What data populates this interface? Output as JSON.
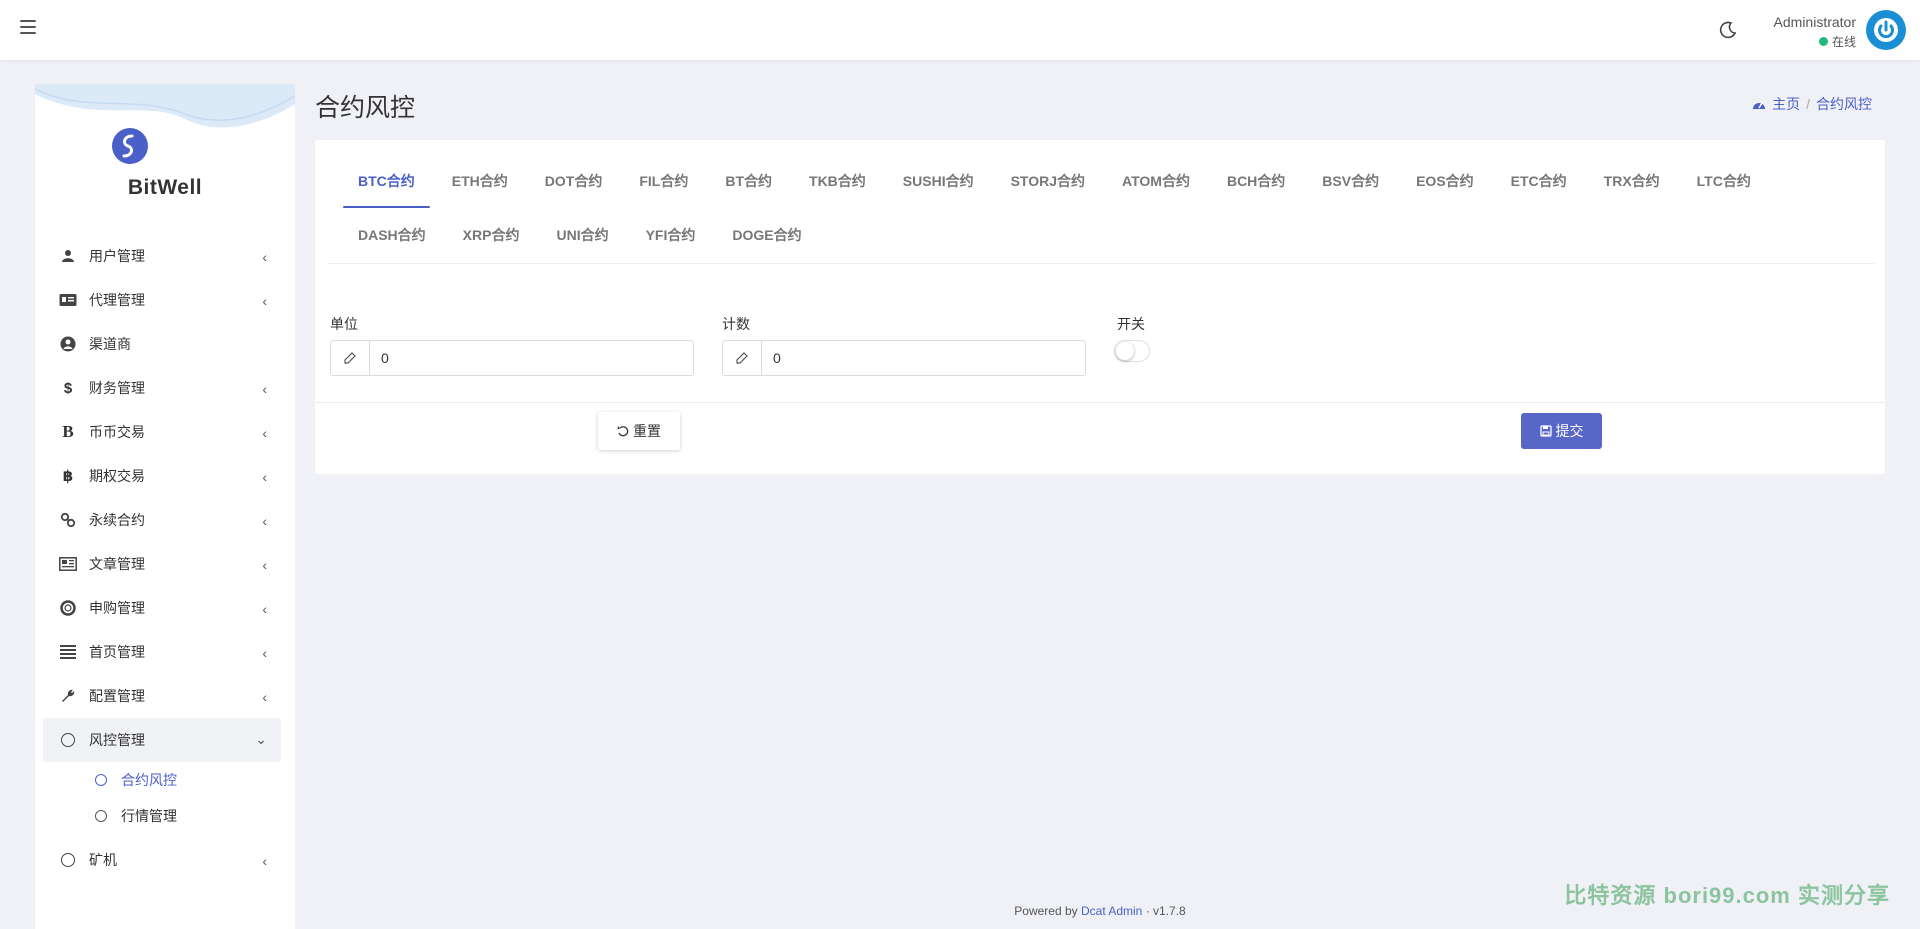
{
  "header": {
    "user_name": "Administrator",
    "user_status": "在线",
    "status_color": "#21b978"
  },
  "sidebar": {
    "logo_text": "BitWell",
    "items": [
      {
        "label": "用户管理",
        "icon": "users-icon"
      },
      {
        "label": "代理管理",
        "icon": "id-card-icon"
      },
      {
        "label": "渠道商",
        "icon": "user-circle-icon"
      },
      {
        "label": "财务管理",
        "icon": "dollar-icon"
      },
      {
        "label": "币币交易",
        "icon": "bold-b-icon"
      },
      {
        "label": "期权交易",
        "icon": "bitcoin-icon"
      },
      {
        "label": "永续合约",
        "icon": "link-icon"
      },
      {
        "label": "文章管理",
        "icon": "newspaper-icon"
      },
      {
        "label": "申购管理",
        "icon": "life-ring-icon"
      },
      {
        "label": "首页管理",
        "icon": "list-icon"
      },
      {
        "label": "配置管理",
        "icon": "wrench-icon"
      },
      {
        "label": "风控管理",
        "icon": "circle-icon"
      }
    ],
    "subitems": [
      {
        "label": "合约风控"
      },
      {
        "label": "行情管理"
      }
    ],
    "last_item": {
      "label": "矿机",
      "icon": "circle-icon"
    }
  },
  "page": {
    "title": "合约风控",
    "breadcrumb_home": "主页",
    "breadcrumb_current": "合约风控",
    "breadcrumb_sep": "/"
  },
  "tabs_row1": [
    "BTC合约",
    "ETH合约",
    "DOT合约",
    "FIL合约",
    "BT合约",
    "TKB合约",
    "SUSHI合约",
    "STORJ合约",
    "ATOM合约",
    "BCH合约",
    "BSV合约",
    "EOS合约",
    "ETC合约",
    "TRX合约",
    "LTC合约"
  ],
  "tabs_row2": [
    "DASH合约",
    "XRP合约",
    "UNI合约",
    "YFI合约",
    "DOGE合约"
  ],
  "form": {
    "unit_label": "单位",
    "unit_value": "0",
    "count_label": "计数",
    "count_value": "0",
    "switch_label": "开关",
    "reset_label": "重置",
    "submit_label": "提交"
  },
  "footer": {
    "powered_prefix": "Powered by",
    "powered_link": "Dcat Admin",
    "sep": "·",
    "version": "v1.7.8"
  },
  "watermark": "比特资源 bori99.com 实测分享",
  "colors": {
    "accent": "#4b5fc8",
    "submit": "#5866c8",
    "background": "#eff1f6"
  }
}
